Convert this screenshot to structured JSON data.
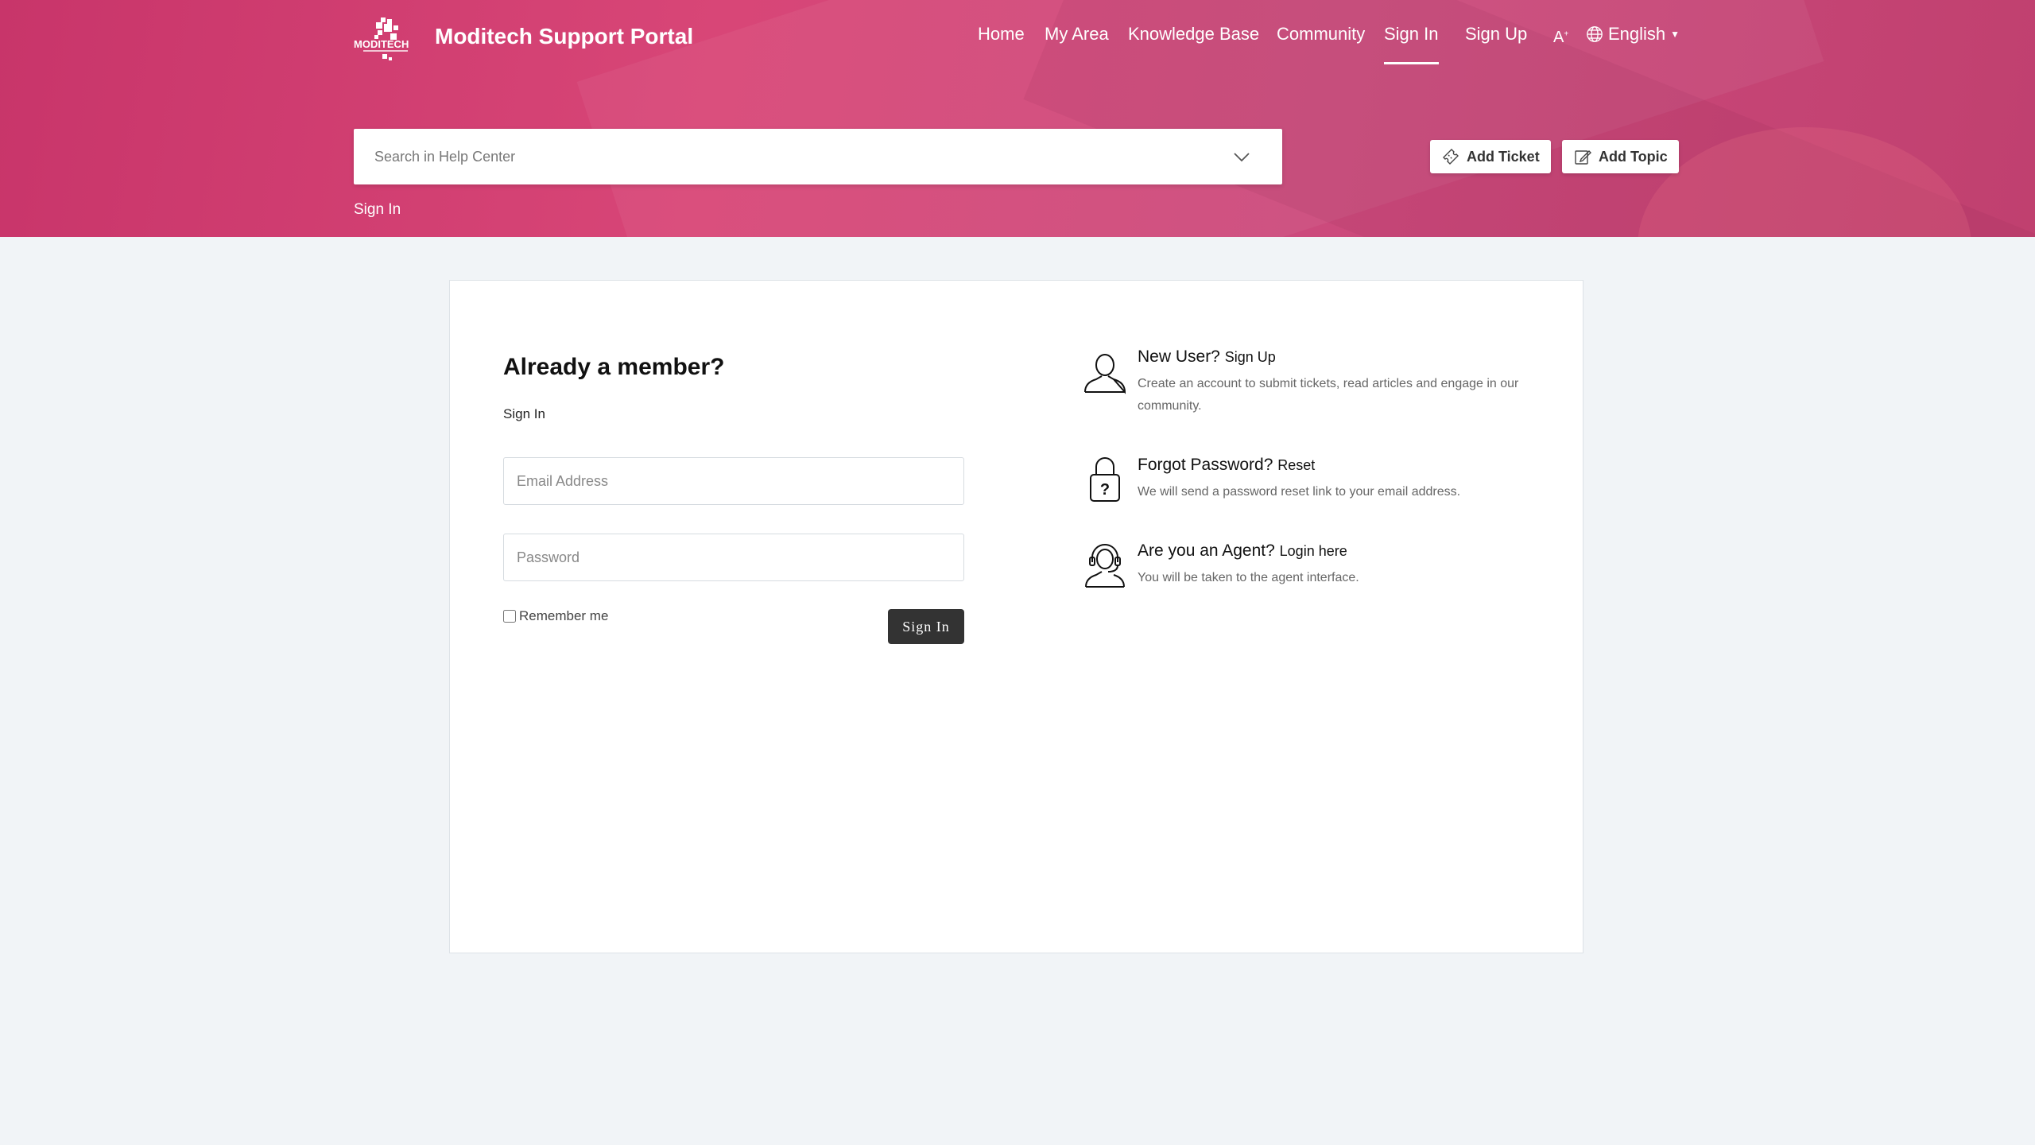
{
  "header": {
    "brand": "Moditech Support Portal",
    "nav": [
      {
        "label": "Home"
      },
      {
        "label": "My Area"
      },
      {
        "label": "Knowledge Base"
      },
      {
        "label": "Community"
      },
      {
        "label": "Sign In",
        "active": true
      },
      {
        "label": "Sign Up"
      }
    ],
    "font_toggle": "A",
    "language": "English",
    "search_placeholder": "Search in Help Center",
    "add_ticket": "Add Ticket",
    "add_topic": "Add Topic",
    "breadcrumb": "Sign In",
    "accent": "#d84677"
  },
  "login": {
    "title": "Already a member?",
    "subtitle": "Sign In",
    "email_placeholder": "Email Address",
    "password_placeholder": "Password",
    "remember_label": "Remember me",
    "submit_label": "Sign In"
  },
  "info": {
    "new_user": {
      "title": "New User?",
      "link": "Sign Up",
      "desc": "Create an account to submit tickets, read articles and engage in our community.",
      "icon": "user-icon"
    },
    "forgot": {
      "title": "Forgot Password?",
      "link": "Reset",
      "desc": "We will send a password reset link to your email address.",
      "icon": "lock-question-icon"
    },
    "agent": {
      "title": "Are you an Agent?",
      "link": "Login here",
      "desc": "You will be taken to the agent interface.",
      "icon": "headset-agent-icon"
    }
  }
}
